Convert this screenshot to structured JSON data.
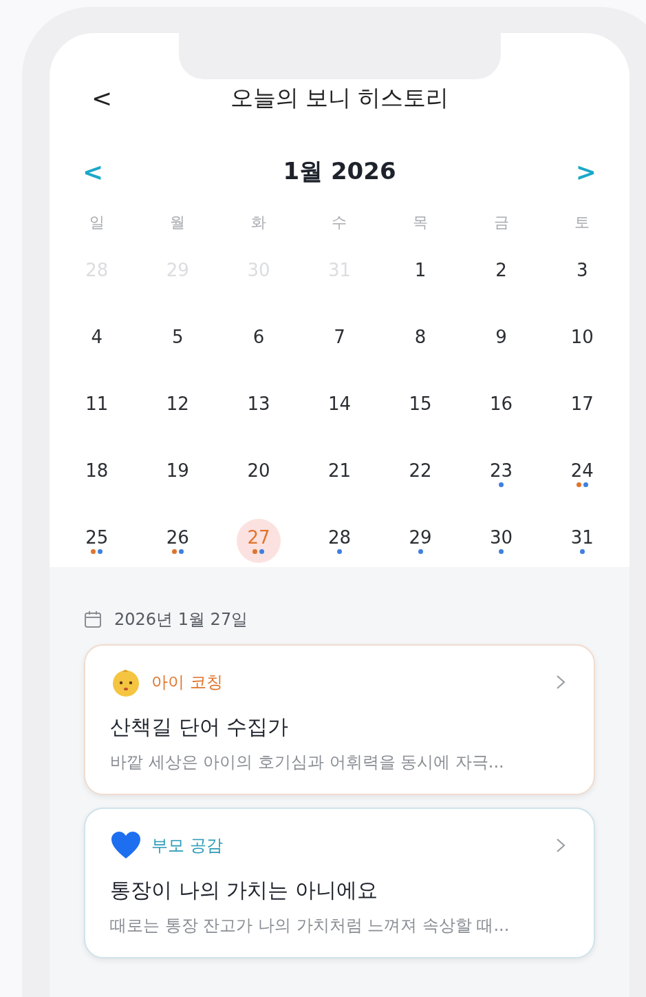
{
  "header": {
    "back": "<",
    "title": "오늘의 보니 히스토리"
  },
  "calendar": {
    "prev": "<",
    "month": "1월 2026",
    "next": ">",
    "weekdays": [
      "일",
      "월",
      "화",
      "수",
      "목",
      "금",
      "토"
    ],
    "days": [
      {
        "day": "28",
        "muted": true,
        "selected": false
      },
      {
        "day": "29",
        "muted": true,
        "selected": false
      },
      {
        "day": "30",
        "muted": true,
        "selected": false
      },
      {
        "day": "31",
        "muted": true,
        "selected": false
      },
      {
        "day": "1",
        "muted": false,
        "selected": false
      },
      {
        "day": "2",
        "muted": false,
        "selected": false
      },
      {
        "day": "3",
        "muted": false,
        "selected": false
      },
      {
        "day": "4",
        "muted": false,
        "selected": false
      },
      {
        "day": "5",
        "muted": false,
        "selected": false
      },
      {
        "day": "6",
        "muted": false,
        "selected": false
      },
      {
        "day": "7",
        "muted": false,
        "selected": false
      },
      {
        "day": "8",
        "muted": false,
        "selected": false
      },
      {
        "day": "9",
        "muted": false,
        "selected": false
      },
      {
        "day": "10",
        "muted": false,
        "selected": false
      },
      {
        "day": "11",
        "muted": false,
        "selected": false
      },
      {
        "day": "12",
        "muted": false,
        "selected": false
      },
      {
        "day": "13",
        "muted": false,
        "selected": false
      },
      {
        "day": "14",
        "muted": false,
        "selected": false
      },
      {
        "day": "15",
        "muted": false,
        "selected": false
      },
      {
        "day": "16",
        "muted": false,
        "selected": false
      },
      {
        "day": "17",
        "muted": false,
        "selected": false
      },
      {
        "day": "18",
        "muted": false,
        "selected": false
      },
      {
        "day": "19",
        "muted": false,
        "selected": false
      },
      {
        "day": "20",
        "muted": false,
        "selected": false
      },
      {
        "day": "21",
        "muted": false,
        "selected": false
      },
      {
        "day": "22",
        "muted": false,
        "selected": false
      },
      {
        "day": "23",
        "muted": false,
        "selected": false,
        "dots": [
          {
            "color": "#3f7fe0"
          }
        ]
      },
      {
        "day": "24",
        "muted": false,
        "selected": false,
        "dots": [
          {
            "color": "#e0742c"
          },
          {
            "color": "#3f7fe0"
          }
        ]
      },
      {
        "day": "25",
        "muted": false,
        "selected": false,
        "dots": [
          {
            "color": "#e0742c"
          },
          {
            "color": "#3f7fe0"
          }
        ]
      },
      {
        "day": "26",
        "muted": false,
        "selected": false,
        "dots": [
          {
            "color": "#e0742c"
          },
          {
            "color": "#3f7fe0"
          }
        ]
      },
      {
        "day": "27",
        "muted": false,
        "selected": true,
        "dots": [
          {
            "color": "#e0742c"
          },
          {
            "color": "#3f7fe0"
          }
        ]
      },
      {
        "day": "28",
        "muted": false,
        "selected": false,
        "dots": [
          {
            "color": "#3f7fe0"
          }
        ]
      },
      {
        "day": "29",
        "muted": false,
        "selected": false,
        "dots": [
          {
            "color": "#3f7fe0"
          }
        ]
      },
      {
        "day": "30",
        "muted": false,
        "selected": false,
        "dots": [
          {
            "color": "#3f7fe0"
          }
        ]
      },
      {
        "day": "31",
        "muted": false,
        "selected": false,
        "dots": [
          {
            "color": "#3f7fe0"
          }
        ]
      }
    ]
  },
  "selected_date": "2026년 1월 27일",
  "entries": [
    {
      "kind": "child",
      "category": "아이 코칭",
      "title": "산책길 단어 수집가",
      "summary": "바깥 세상은 아이의 호기심과 어휘력을 동시에 자극..."
    },
    {
      "kind": "parent",
      "category": "부모 공감",
      "title": "통장이 나의 가치는 아니에요",
      "summary": "때로는 통장 잔고가 나의 가치처럼 느껴져 속상할 때..."
    }
  ]
}
